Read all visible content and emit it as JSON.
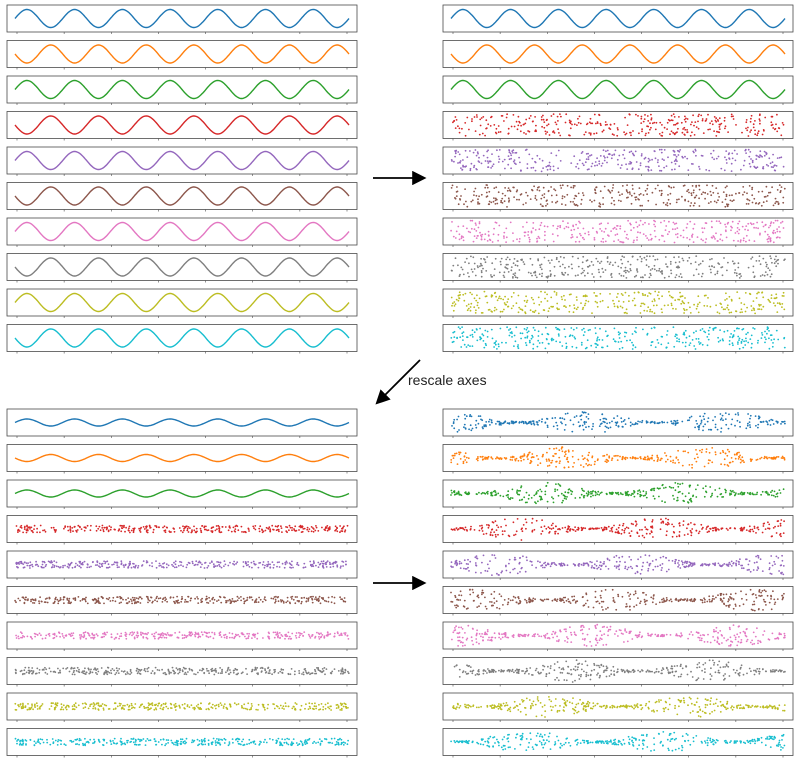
{
  "caption": "rescale axes",
  "colors": [
    "#1f77b4",
    "#ff7f0e",
    "#2ca02c",
    "#d62728",
    "#9467bd",
    "#8c564b",
    "#e377c2",
    "#7f7f7f",
    "#bcbd22",
    "#17becf"
  ],
  "panels": [
    {
      "id": "top-left",
      "rows": [
        "sine",
        "sine",
        "sine",
        "sine",
        "sine",
        "sine",
        "sine",
        "sine",
        "sine",
        "sine"
      ],
      "scale": "full"
    },
    {
      "id": "top-right",
      "rows": [
        "sine",
        "sine",
        "sine",
        "noise",
        "noise",
        "noise",
        "noise",
        "noise",
        "noise",
        "noise"
      ],
      "scale": "full"
    },
    {
      "id": "bottom-left",
      "rows": [
        "sine",
        "sine",
        "sine",
        "noise",
        "noise",
        "noise",
        "noise",
        "noise",
        "noise",
        "noise"
      ],
      "scale": "shared"
    },
    {
      "id": "bottom-right",
      "rows": [
        "noise",
        "noise",
        "noise",
        "noise",
        "noise",
        "noise",
        "noise",
        "noise",
        "noise",
        "noise"
      ],
      "scale": "rescaled"
    }
  ],
  "arrows": [
    {
      "from": "top-left",
      "to": "top-right"
    },
    {
      "from": "top-right",
      "to": "bottom-left",
      "label": "caption"
    },
    {
      "from": "bottom-left",
      "to": "bottom-right"
    }
  ]
}
